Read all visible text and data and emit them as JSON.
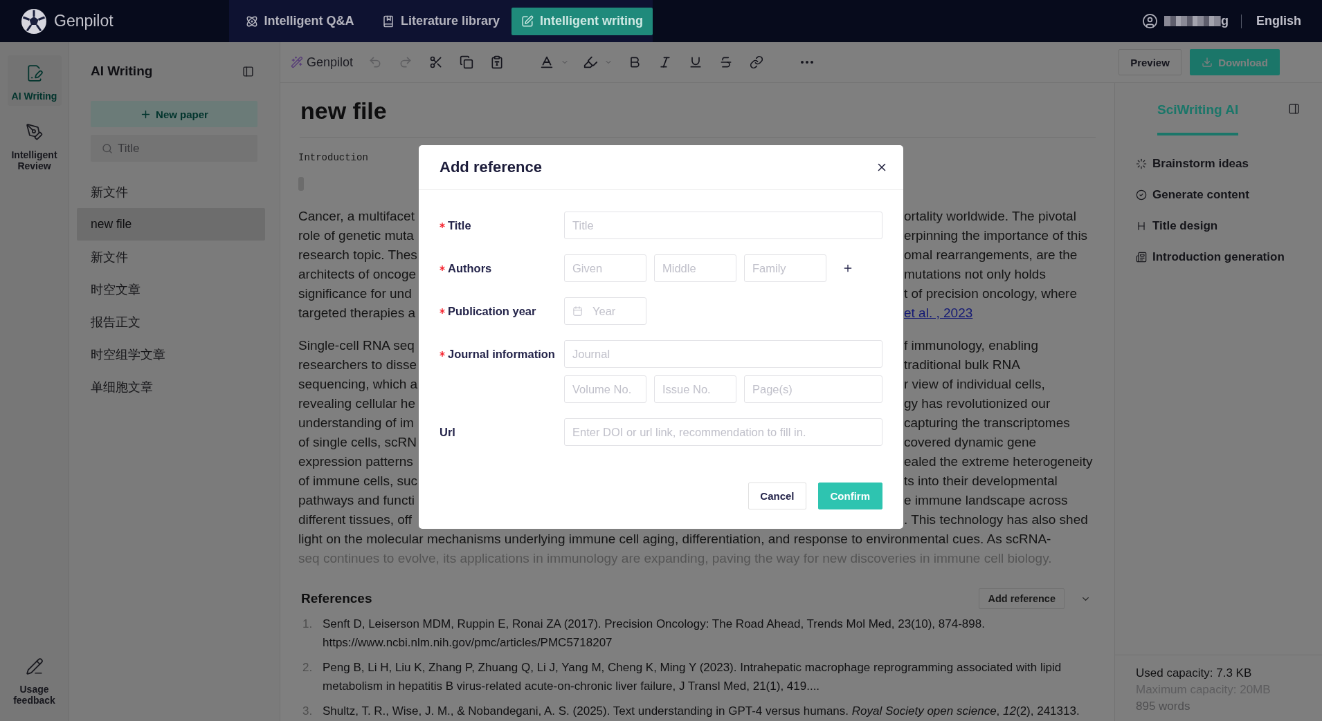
{
  "topbar": {
    "brand": "Genpilot",
    "nav": [
      {
        "label": "Intelligent Q&A",
        "selected": false
      },
      {
        "label": "Literature library",
        "selected": false
      },
      {
        "label": "Intelligent writing",
        "selected": true
      }
    ],
    "user_name": "g",
    "language": "English"
  },
  "rail": {
    "items": [
      {
        "label": "AI Writing",
        "selected": true
      },
      {
        "label": "Intelligent Review",
        "selected": false
      }
    ],
    "feedback": "Usage feedback"
  },
  "files": {
    "title": "AI Writing",
    "new_button": "New paper",
    "search": {
      "placeholder": "Title"
    },
    "items": [
      {
        "label": "新文件",
        "selected": false
      },
      {
        "label": "new file",
        "selected": true
      },
      {
        "label": "新文件",
        "selected": false
      },
      {
        "label": "时空文章",
        "selected": false
      },
      {
        "label": "报告正文",
        "selected": false
      },
      {
        "label": "时空组学文章",
        "selected": false
      },
      {
        "label": "单细胞文章",
        "selected": false
      }
    ]
  },
  "toolbar": {
    "brand": "Genpilot",
    "tools": [
      {
        "kind": "undo",
        "disabled": true
      },
      {
        "kind": "redo",
        "disabled": true
      },
      {
        "kind": "cut",
        "disabled": false
      },
      {
        "kind": "copy",
        "disabled": false
      },
      {
        "kind": "paste",
        "disabled": false
      },
      {
        "kind": "font-color",
        "disabled": false
      },
      {
        "kind": "highlight",
        "disabled": false
      },
      {
        "kind": "bold",
        "disabled": false
      },
      {
        "kind": "italic",
        "disabled": false
      },
      {
        "kind": "underline",
        "disabled": false
      },
      {
        "kind": "strikethrough",
        "disabled": false
      },
      {
        "kind": "link",
        "disabled": false
      },
      {
        "kind": "more",
        "disabled": false
      }
    ],
    "preview": "Preview",
    "download": "Download"
  },
  "document": {
    "title": "new file",
    "section": "Introduction",
    "paragraphs": [
      {
        "lines": [
          {
            "start": "Cancer, a multifacet",
            "end": "ortality worldwide. The pivotal"
          },
          {
            "start": "role of genetic muta",
            "end": "erpinning the importance of this"
          },
          {
            "start": "research topic. Thes",
            "end": "omal rearrangements, are the"
          },
          {
            "start": "architects of oncoge",
            "end": "mutations not only holds"
          },
          {
            "start": "significance for und",
            "end": "t of precision oncology, where"
          },
          {
            "start": "targeted therapies a",
            "link": "et al. , 2023"
          }
        ]
      },
      {
        "lines": [
          {
            "start": "Single-cell RNA seq",
            "end": "f immunology, enabling",
            "faded": false
          },
          {
            "start": "researchers to disse",
            "end": "traditional bulk RNA",
            "faded": false
          },
          {
            "start": "sequencing, which a",
            "end": "r view of individual cells,",
            "faded": false
          },
          {
            "start": "revealing cellular he",
            "end": "gy has revolutionized our",
            "faded": false
          },
          {
            "start": "understanding of im",
            "end": "capturing the transcriptomes",
            "faded": false
          },
          {
            "start": "of single cells, scRN",
            "end": "covered dynamic gene",
            "faded": false
          },
          {
            "start": "expression patterns",
            "end": "ealed the extreme heterogeneity",
            "faded": false
          },
          {
            "start": "of immune cells, suc",
            "end": "ts into their developmental",
            "faded": false
          },
          {
            "start": "pathways and functi",
            "end": "e immune landscape across",
            "faded": false
          },
          {
            "start": "different tissues, off",
            "end": ". This technology has also shed",
            "faded": false
          },
          {
            "text": "light on the molecular mechanisms underlying immune cell aging, differentiation, and response to environmental cues. As scRNA-",
            "faded": false
          },
          {
            "text": "seq continues to evolve, its applications in immunology are expanding, paving the way for new discoveries in immune cell biology.",
            "faded": true
          }
        ]
      }
    ],
    "references": {
      "heading": "References",
      "add_button": "Add reference",
      "items": [
        {
          "number": "1.",
          "text": "Senft D, Leiserson MDM, Ruppin E, Ronai ZA (2017). Precision Oncology: The Road Ahead, Trends Mol Med, 23(10), 874-898. https://www.ncbi.nlm.nih.gov/pmc/articles/PMC5718207"
        },
        {
          "number": "2.",
          "text": "Peng B, Li H, Liu K, Zhang P, Zhuang Q, Li J, Yang M, Cheng K, Ming Y (2023). Intrahepatic macrophage reprogramming associated with lipid metabolism in hepatitis B virus-related acute-on-chronic liver failure, J Transl Med, 21(1), 419...."
        },
        {
          "number": "3.",
          "text": "Shultz, T. R., Wise, J. M., & Nobandegani, A. S. (2025). Text understanding in GPT-4 versus humans. *Royal Society open science*, *12*(2), 241313."
        }
      ]
    }
  },
  "assistant": {
    "tabs": [
      {
        "label": "SciWriting AI",
        "selected": true
      }
    ],
    "actions": [
      "Brainstorm ideas",
      "Generate content",
      "Title design",
      "Introduction generation"
    ],
    "usage": {
      "used": "Used capacity: 7.3 KB",
      "maximum": "Maximum capacity: 20MB",
      "words": "895 words"
    }
  },
  "modal": {
    "title": "Add reference",
    "fields": [
      {
        "kind": "text",
        "label": "Title",
        "required": true,
        "placeholder": "Title"
      },
      {
        "kind": "names",
        "label": "Authors",
        "required": true,
        "inputs": [
          {
            "placeholder": "Given"
          },
          {
            "placeholder": "Middle"
          },
          {
            "placeholder": "Family"
          }
        ]
      },
      {
        "kind": "date",
        "label": "Publication year",
        "required": true,
        "placeholder": "Year"
      },
      {
        "kind": "journal",
        "label": "Journal information",
        "required": true,
        "placeholder": "Journal",
        "details": [
          {
            "placeholder": "Volume No."
          },
          {
            "placeholder": "Issue No."
          },
          {
            "placeholder": "Page(s)"
          }
        ]
      },
      {
        "kind": "text",
        "label": "Url",
        "required": false,
        "placeholder": "Enter DOI or url link, recommendation to fill in."
      }
    ],
    "actions": [
      {
        "label": "Cancel",
        "kind": "secondary"
      },
      {
        "label": "Confirm",
        "kind": "primary"
      }
    ]
  }
}
